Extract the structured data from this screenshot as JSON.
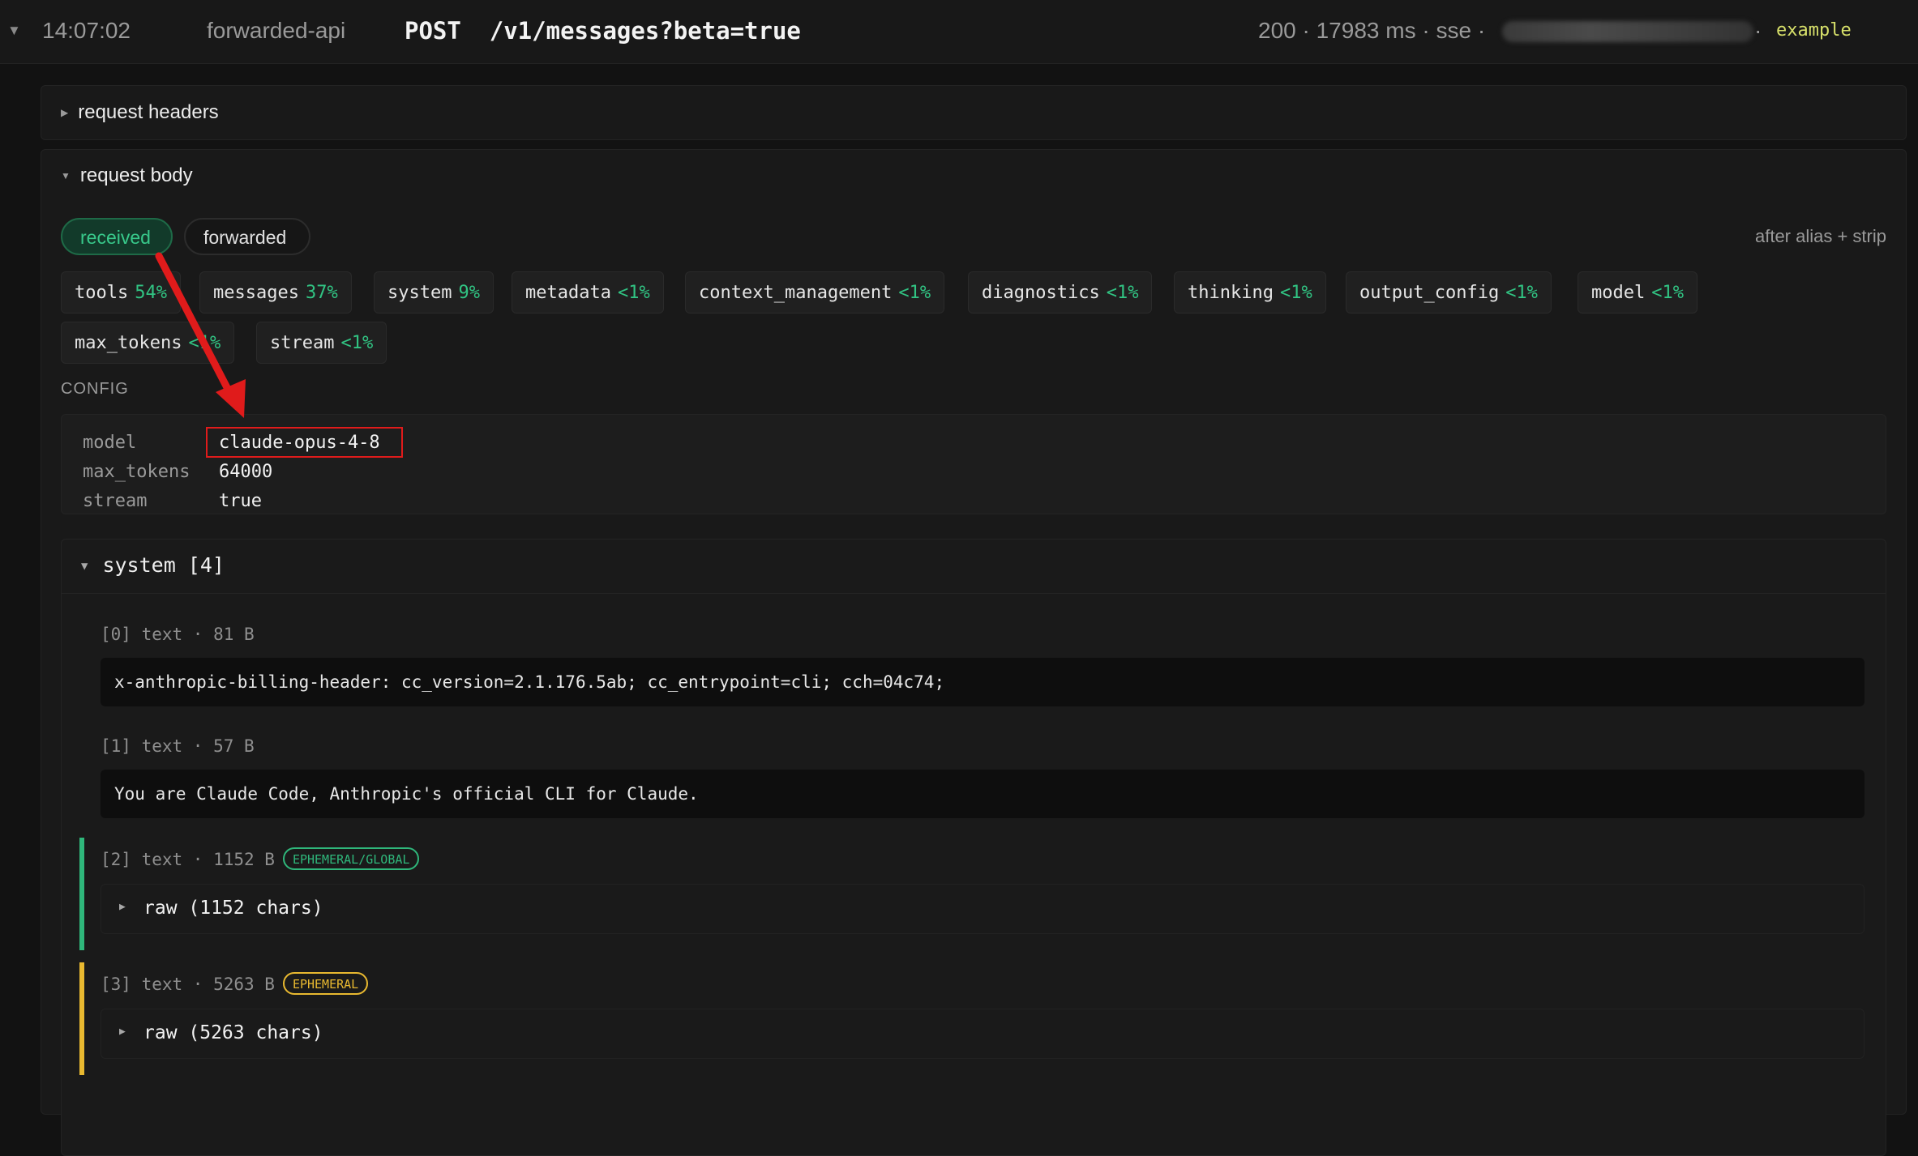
{
  "log_row": {
    "expanded_icon": "caret-down-icon",
    "time": "14:07:02",
    "service": "forwarded-api",
    "method": "POST",
    "path": "/v1/messages?beta=true",
    "status": "200",
    "duration": "17983 ms",
    "mode": "sse",
    "separator": "·",
    "tag": "example"
  },
  "request_headers": {
    "title": "request headers",
    "expanded": false
  },
  "request_body": {
    "title": "request body",
    "expanded": true,
    "toggle": {
      "received": "received",
      "forwarded": "forwarded",
      "active": "received"
    },
    "note": "after alias + strip",
    "keys": [
      {
        "name": "tools",
        "pct": "54%"
      },
      {
        "name": "messages",
        "pct": "37%"
      },
      {
        "name": "system",
        "pct": "9%"
      },
      {
        "name": "metadata",
        "pct": "<1%"
      },
      {
        "name": "context_management",
        "pct": "<1%"
      },
      {
        "name": "diagnostics",
        "pct": "<1%"
      },
      {
        "name": "thinking",
        "pct": "<1%"
      },
      {
        "name": "output_config",
        "pct": "<1%"
      },
      {
        "name": "model",
        "pct": "<1%"
      },
      {
        "name": "max_tokens",
        "pct": "<1%"
      },
      {
        "name": "stream",
        "pct": "<1%"
      }
    ],
    "config_label": "CONFIG",
    "config": [
      {
        "key": "model",
        "value": "claude-opus-4-8"
      },
      {
        "key": "max_tokens",
        "value": "64000"
      },
      {
        "key": "stream",
        "value": "true"
      }
    ],
    "system": {
      "title": "system [4]",
      "items": [
        {
          "meta": "[0] text · 81 B",
          "content": "x-anthropic-billing-header: cc_version=2.1.176.5ab; cc_entrypoint=cli; cch=04c74;"
        },
        {
          "meta": "[1] text · 57 B",
          "content": "You are Claude Code, Anthropic's official CLI for Claude."
        },
        {
          "meta": "[2] text · 1152 B",
          "badge": "EPHEMERAL/GLOBAL",
          "badge_color": "#2fb77b",
          "raw_label": "raw (1152 chars)"
        },
        {
          "meta": "[3] text · 5263 B",
          "badge": "EPHEMERAL",
          "badge_color": "#e9b930",
          "raw_label": "raw (5263 chars)"
        }
      ]
    }
  },
  "annotation": {
    "arrow_color": "#e01b1b",
    "highlight_color": "#e01b1b"
  }
}
